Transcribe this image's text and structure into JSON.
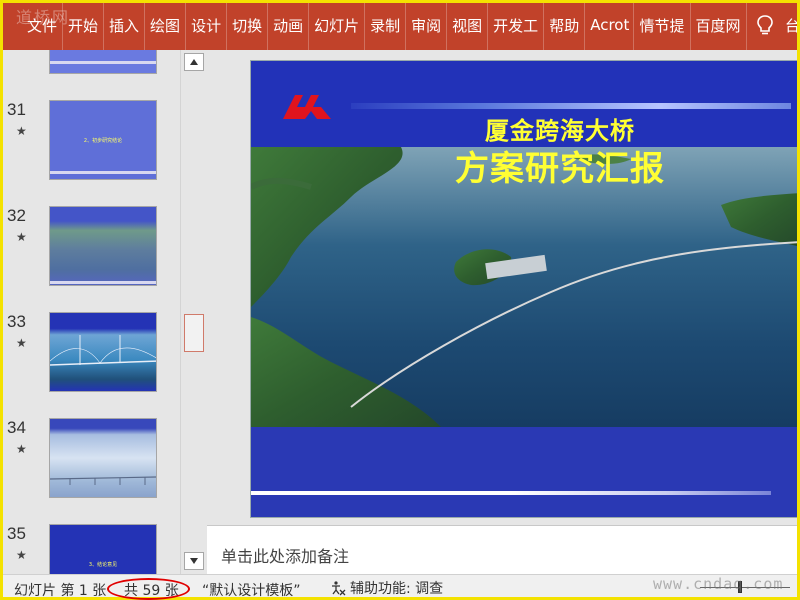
{
  "watermark_top": "道桥网",
  "watermark_bottom": "www.cndaq.com",
  "ribbon": {
    "tabs": [
      {
        "label": "文件"
      },
      {
        "label": "开始"
      },
      {
        "label": "插入"
      },
      {
        "label": "绘图"
      },
      {
        "label": "设计"
      },
      {
        "label": "切换"
      },
      {
        "label": "动画"
      },
      {
        "label": "幻灯片"
      },
      {
        "label": "录制"
      },
      {
        "label": "审阅"
      },
      {
        "label": "视图"
      },
      {
        "label": "开发工"
      },
      {
        "label": "帮助"
      },
      {
        "label": "Acrot"
      },
      {
        "label": "情节提"
      },
      {
        "label": "百度网"
      }
    ],
    "lightbulb_icon": "lightbulb-icon",
    "overflow_label": "台"
  },
  "thumbnails": [
    {
      "number": "",
      "star": "",
      "title": "",
      "style": "plain"
    },
    {
      "number": "31",
      "star": "★",
      "title": "2、初步研究结论",
      "style": "plain"
    },
    {
      "number": "32",
      "star": "★",
      "title": "",
      "style": "photo-green"
    },
    {
      "number": "33",
      "star": "★",
      "title": "",
      "style": "bridge"
    },
    {
      "number": "34",
      "star": "★",
      "title": "",
      "style": "sky"
    },
    {
      "number": "35",
      "star": "★",
      "title": "3、结论意见",
      "style": "dark"
    }
  ],
  "slide": {
    "title_line1": "厦金跨海大桥",
    "title_line2": "方案研究汇报"
  },
  "notes": {
    "placeholder": "单击此处添加备注"
  },
  "status": {
    "slide_label": "幻灯片 第 1 张",
    "total_label": "共 59 张",
    "theme_label": "“默认设计模板”",
    "accessibility_label": "辅助功能: 调查"
  },
  "colors": {
    "ribbon": "#c1422a",
    "slide_blue": "#2d3bb0",
    "title_yellow": "#ffff33",
    "highlight_red": "#e00000",
    "frame_yellow": "#f4e200"
  }
}
